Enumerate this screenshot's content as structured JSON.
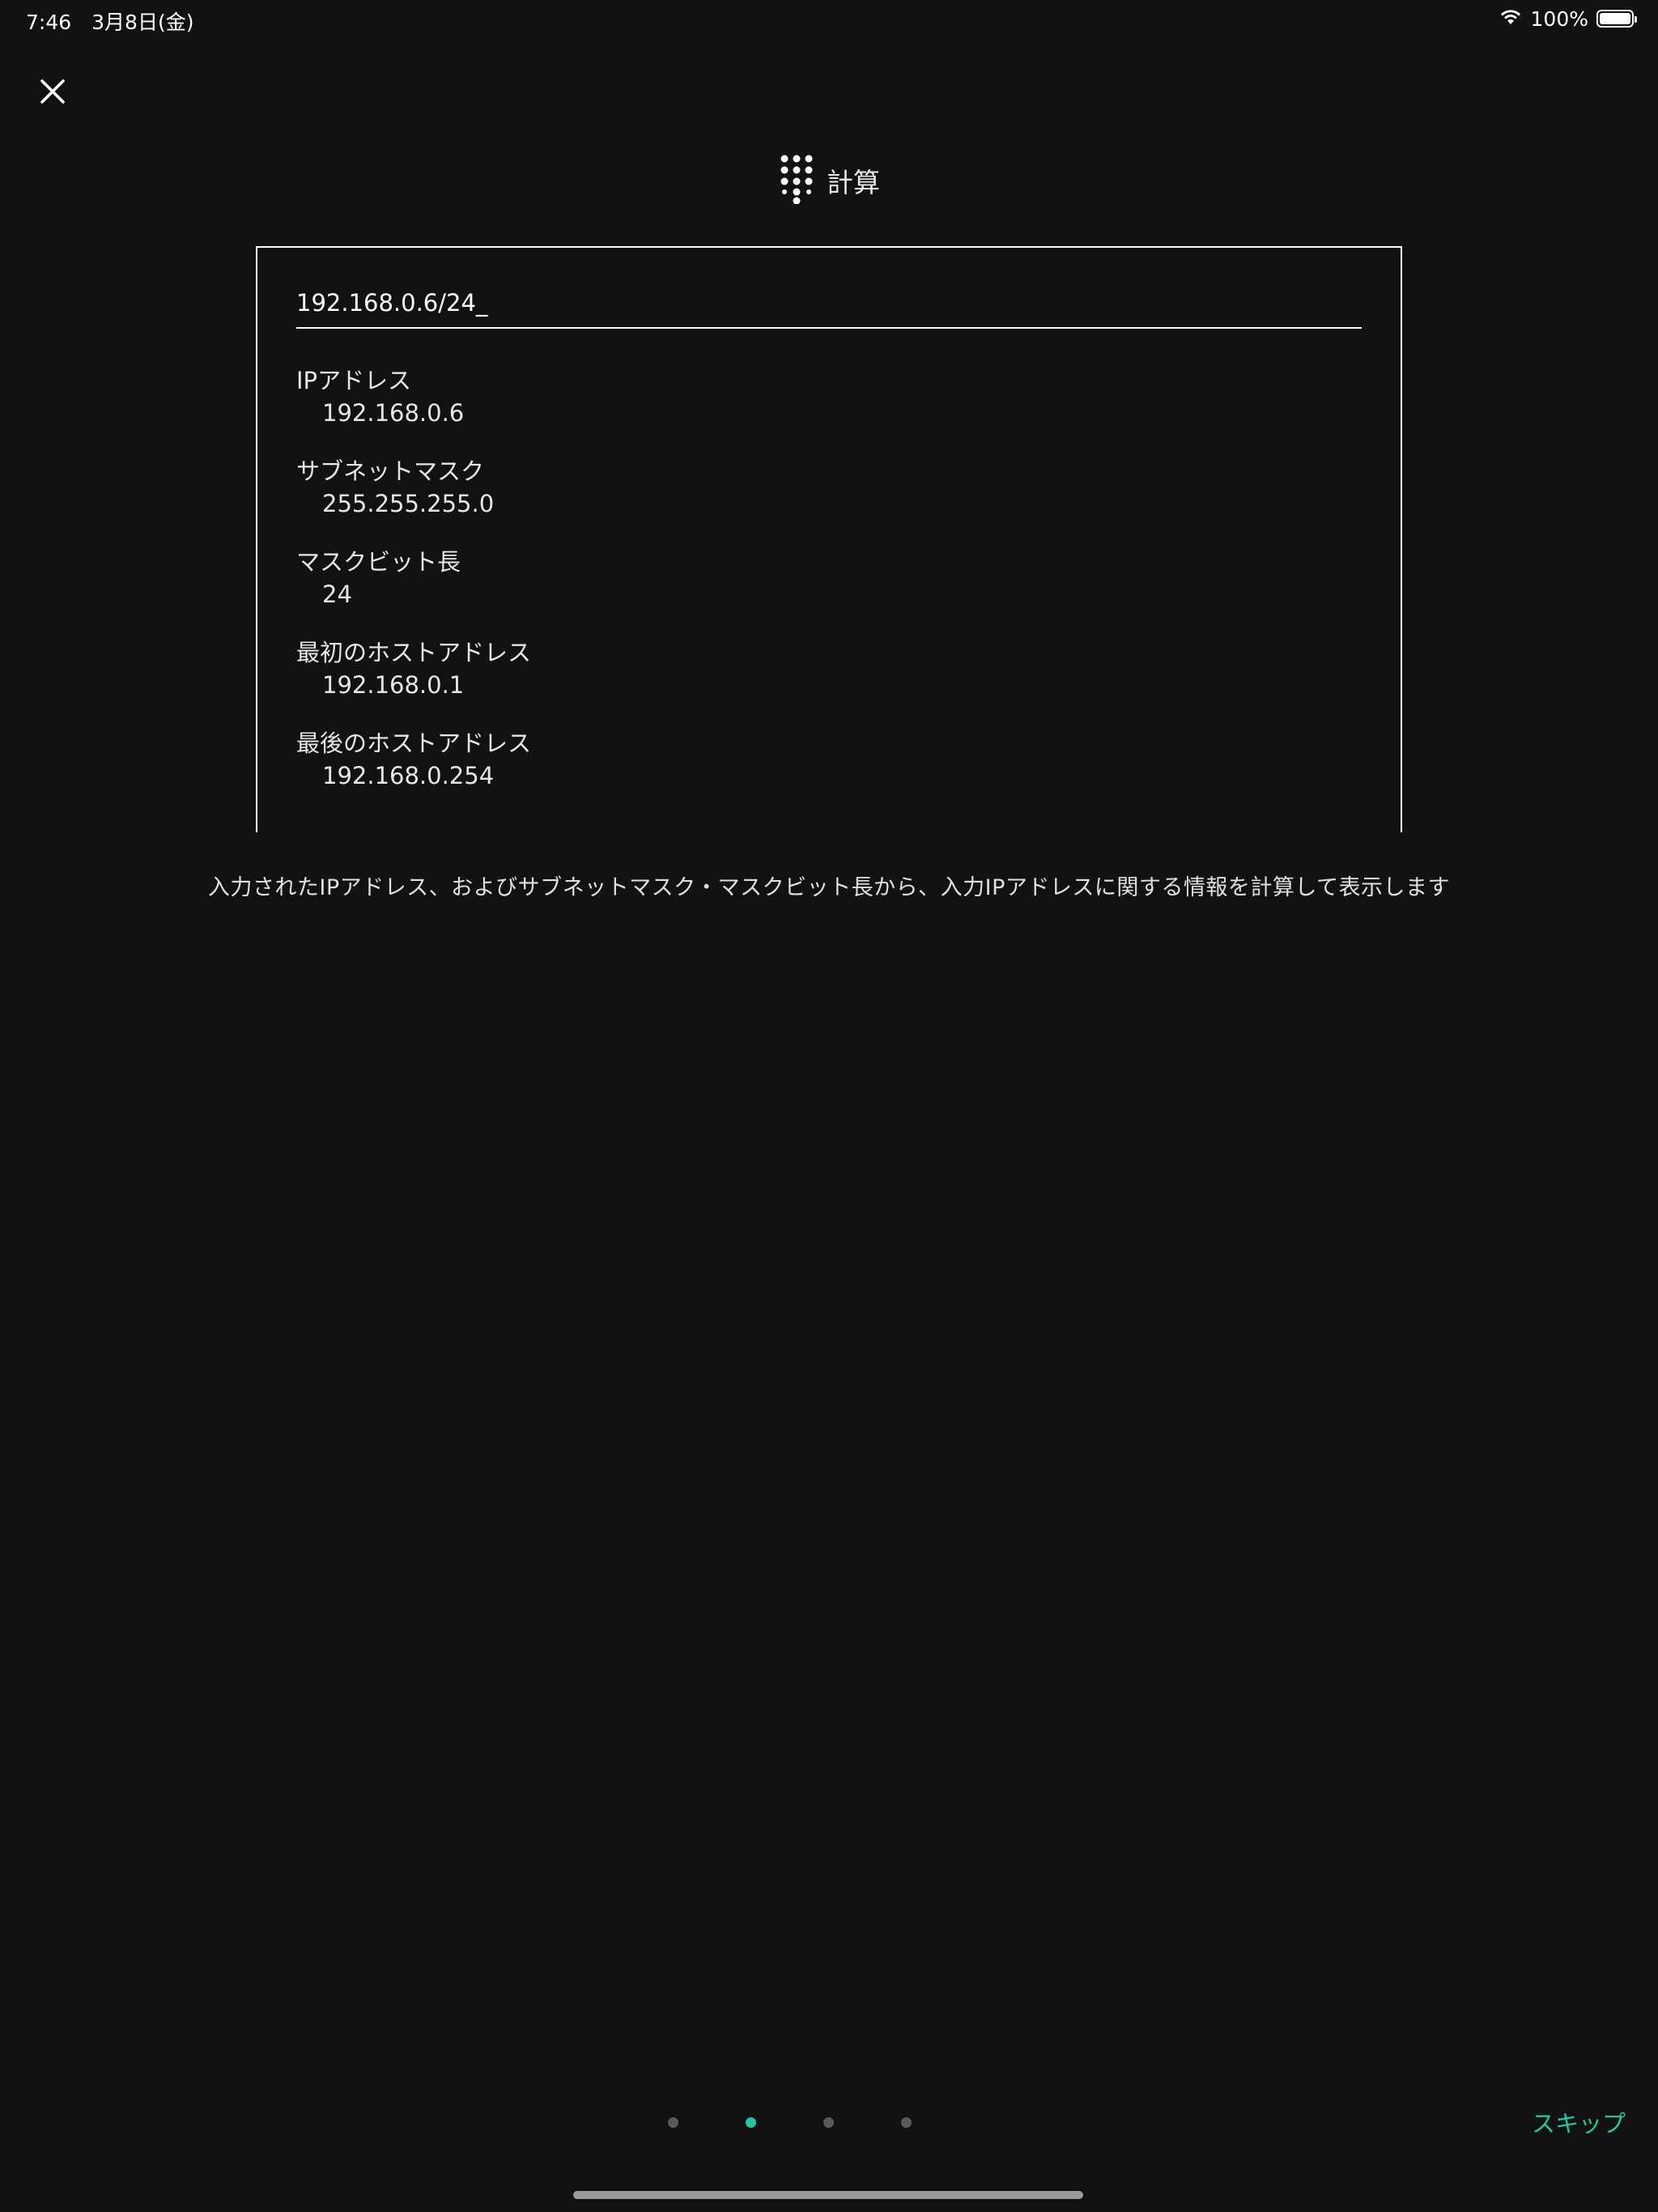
{
  "status_bar": {
    "time": "7:46　3月8日(金)",
    "battery_text": "100%",
    "battery_level": 1.0
  },
  "header": {
    "icon": "dialpad-icon",
    "title": "計算"
  },
  "calculator": {
    "input_value": "192.168.0.6/24_",
    "results": [
      {
        "label": "IPアドレス",
        "value": "192.168.0.6"
      },
      {
        "label": "サブネットマスク",
        "value": "255.255.255.0"
      },
      {
        "label": "マスクビット長",
        "value": "24"
      },
      {
        "label": "最初のホストアドレス",
        "value": "192.168.0.1"
      },
      {
        "label": "最後のホストアドレス",
        "value": "192.168.0.254"
      }
    ]
  },
  "description": "入力されたIPアドレス、およびサブネットマスク・マスクビット長から、入力IPアドレスに関する情報を計算して表示します",
  "pager": {
    "page_count": 4,
    "current_page": 2
  },
  "skip_label": "スキップ",
  "colors": {
    "background": "#121212",
    "accent": "#1fc7a0",
    "text": "#ffffff"
  }
}
